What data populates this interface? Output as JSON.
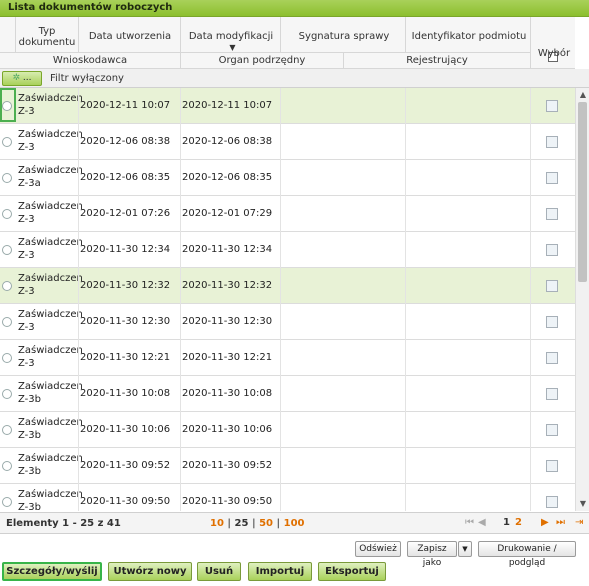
{
  "title": "Lista dokumentów roboczych",
  "columns": {
    "typ": "Typ dokumentu",
    "data_utworzenia": "Data utworzenia",
    "data_modyfikacji": "Data modyfikacji",
    "sygnatura": "Sygnatura sprawy",
    "identyfikator": "Identyfikator podmiotu",
    "wybor": "Wybór",
    "wnioskodawca": "Wnioskodawca",
    "organ": "Organ podrzędny",
    "rejestrujacy": "Rejestrujący",
    "sort_icon": "triangle-down"
  },
  "filter": {
    "button_label": "...",
    "status": "Filtr wyłączony"
  },
  "rows": [
    {
      "typ1": "Zaświadczen",
      "typ2": "Z-3",
      "created": "2020-12-11 10:07",
      "modified": "2020-12-11 10:07",
      "highlight": true,
      "focused": true
    },
    {
      "typ1": "Zaświadczen",
      "typ2": "Z-3",
      "created": "2020-12-06 08:38",
      "modified": "2020-12-06 08:38",
      "highlight": false
    },
    {
      "typ1": "Zaświadczen",
      "typ2": "Z-3a",
      "created": "2020-12-06 08:35",
      "modified": "2020-12-06 08:35",
      "highlight": false
    },
    {
      "typ1": "Zaświadczen",
      "typ2": "Z-3",
      "created": "2020-12-01 07:26",
      "modified": "2020-12-01 07:29",
      "highlight": false
    },
    {
      "typ1": "Zaświadczen",
      "typ2": "Z-3",
      "created": "2020-11-30 12:34",
      "modified": "2020-11-30 12:34",
      "highlight": false
    },
    {
      "typ1": "Zaświadczen",
      "typ2": "Z-3",
      "created": "2020-11-30 12:32",
      "modified": "2020-11-30 12:32",
      "highlight": true
    },
    {
      "typ1": "Zaświadczen",
      "typ2": "Z-3",
      "created": "2020-11-30 12:30",
      "modified": "2020-11-30 12:30",
      "highlight": false
    },
    {
      "typ1": "Zaświadczen",
      "typ2": "Z-3",
      "created": "2020-11-30 12:21",
      "modified": "2020-11-30 12:21",
      "highlight": false
    },
    {
      "typ1": "Zaświadczen",
      "typ2": "Z-3b",
      "created": "2020-11-30 10:08",
      "modified": "2020-11-30 10:08",
      "highlight": false
    },
    {
      "typ1": "Zaświadczen",
      "typ2": "Z-3b",
      "created": "2020-11-30 10:06",
      "modified": "2020-11-30 10:06",
      "highlight": false
    },
    {
      "typ1": "Zaświadczen",
      "typ2": "Z-3b",
      "created": "2020-11-30 09:52",
      "modified": "2020-11-30 09:52",
      "highlight": false
    },
    {
      "typ1": "Zaświadczen",
      "typ2": "Z-3b",
      "created": "2020-11-30 09:50",
      "modified": "2020-11-30 09:50",
      "highlight": false
    }
  ],
  "pager": {
    "elements": "Elementy 1 - 25 z 41",
    "sizes": [
      "10",
      "25",
      "50",
      "100"
    ],
    "current_size": "25",
    "pages": [
      "1",
      "2"
    ],
    "current_page": "1"
  },
  "toolbar": {
    "refresh": "Odśwież",
    "save_as": "Zapisz jako",
    "print": "Drukowanie / podgląd"
  },
  "buttons": {
    "details": "Szczegóły/wyślij",
    "create": "Utwórz nowy",
    "delete": "Usuń",
    "import": "Importuj",
    "export": "Eksportuj"
  },
  "colors": {
    "accent": "#a9d15a",
    "highlight_row": "#e8f2d6",
    "page_link": "#e07000",
    "focus": "#38b449"
  }
}
